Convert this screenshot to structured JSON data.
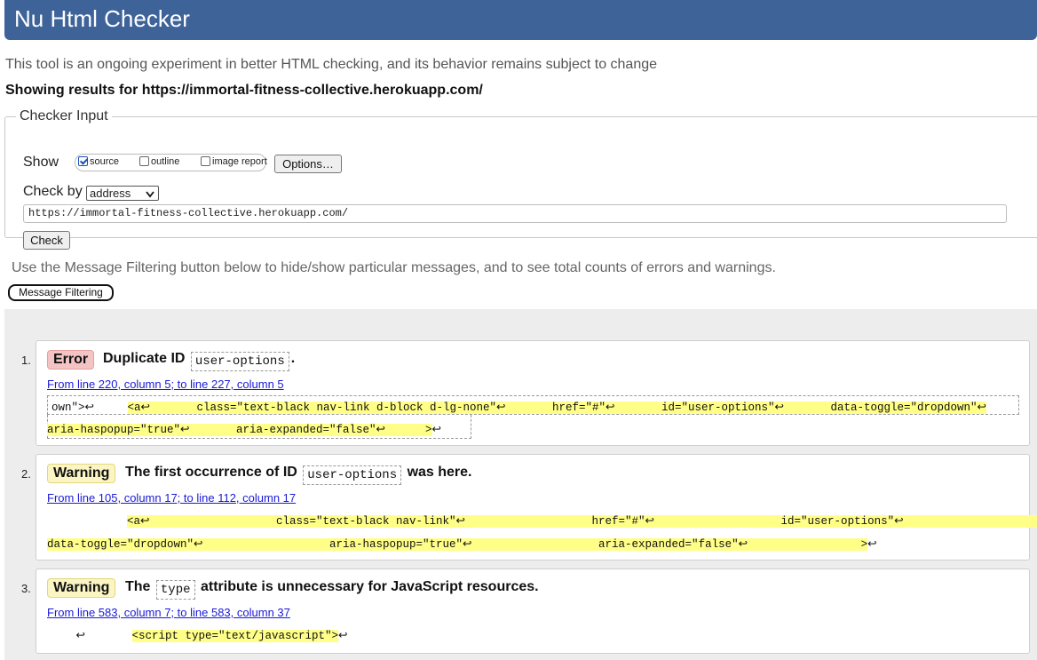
{
  "header": {
    "title": "Nu Html Checker"
  },
  "subtitle": "This tool is an ongoing experiment in better HTML checking, and its behavior remains subject to change",
  "results_for": "Showing results for https://immortal-fitness-collective.herokuapp.com/",
  "checker_input": {
    "legend": "Checker Input",
    "show_label": "Show",
    "options": [
      {
        "label": "source",
        "checked": true
      },
      {
        "label": "outline",
        "checked": false
      },
      {
        "label": "image report",
        "checked": false
      }
    ],
    "options_button": "Options…",
    "check_by_label": "Check by",
    "check_by_value": "address",
    "url_value": "https://immortal-fitness-collective.herokuapp.com/",
    "check_button": "Check"
  },
  "filter_note": "Use the Message Filtering button below to hide/show particular messages, and to see total counts of errors and warnings.",
  "filter_button": "Message Filtering",
  "messages": [
    {
      "number": "1.",
      "type": "Error",
      "text_before": "Duplicate ID",
      "code": "user-options",
      "text_after": ".",
      "location": "From line 220, column 5; to line 227, column 5",
      "line1_prefix": "own\">↩     ",
      "line1_highlight": "<a↩       class=\"text-black nav-link d-block d-lg-none\"↩       href=\"#\"↩       id=\"user-options\"↩       data-toggle=\"dropdown\"↩",
      "line2_highlight": "aria-haspopup=\"true\"↩       aria-expanded=\"false\"↩      >",
      "line2_suffix": "↩"
    },
    {
      "number": "2.",
      "type": "Warning",
      "text_before": "The first occurrence of ID",
      "code": "user-options",
      "text_after": "was here.",
      "location": "From line 105, column 17; to line 112, column 17",
      "line1_prefix": "            ",
      "line1_highlight": "<a↩                   class=\"text-black nav-link\"↩                   href=\"#\"↩                   id=\"user-options\"↩                      ",
      "line2_highlight": "data-toggle=\"dropdown\"↩                   aria-haspopup=\"true\"↩                   aria-expanded=\"false\"↩                 >",
      "line2_suffix": "↩"
    },
    {
      "number": "3.",
      "type": "Warning",
      "text_before": "The",
      "code": "type",
      "text_after": "attribute is unnecessary for JavaScript resources.",
      "location": "From line 583, column 7; to line 583, column 37",
      "line1_prefix": "   ↩       ",
      "line1_highlight": "<script type=\"text/javascript\">",
      "line1_suffix": "↩"
    }
  ]
}
